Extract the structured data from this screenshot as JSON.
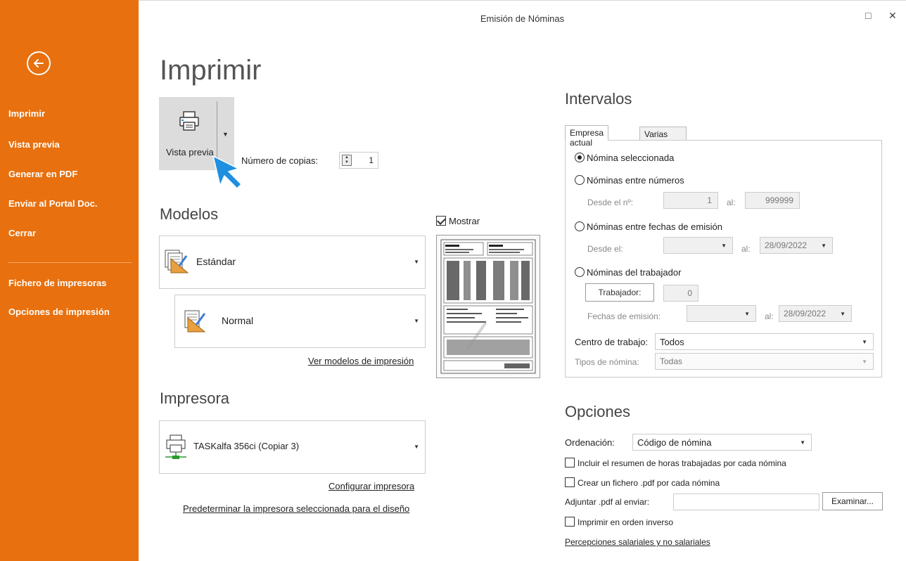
{
  "window": {
    "title": "Emisión de Nóminas",
    "controls": {
      "maximize": "□",
      "close": "✕"
    }
  },
  "sidebar": {
    "items": [
      {
        "label": "Imprimir"
      },
      {
        "label": "Vista previa"
      },
      {
        "label": "Generar en PDF"
      },
      {
        "label": "Enviar al Portal Doc."
      },
      {
        "label": "Cerrar"
      },
      {
        "label": "Fichero de impresoras"
      },
      {
        "label": "Opciones de impresión"
      }
    ]
  },
  "main": {
    "title": "Imprimir",
    "print_button": {
      "label": "Vista previa",
      "icon": "printer-icon"
    },
    "copies": {
      "label": "Número de copias:",
      "value": "1"
    },
    "modelos": {
      "heading": "Modelos",
      "model": "Estándar",
      "submodel": "Normal",
      "link": "Ver modelos de impresión",
      "show_label": "Mostrar",
      "show_checked": true
    },
    "impresora": {
      "heading": "Impresora",
      "printer": "TASKalfa 356ci (Copiar 3)",
      "configure_link": "Configurar impresora",
      "default_link": "Predeterminar la impresora seleccionada para el diseño"
    }
  },
  "intervalos": {
    "heading": "Intervalos",
    "tabs": [
      "Empresa actual",
      "Varias empresas"
    ],
    "opt1": "Nómina seleccionada",
    "opt2": "Nóminas entre números",
    "desde_no_label": "Desde el nº:",
    "desde_no_value": "1",
    "al_label": "al:",
    "al_no_value": "999999",
    "opt3": "Nóminas entre fechas de emisión",
    "desde_el_label": "Desde el:",
    "al_fecha_value": "28/09/2022",
    "opt4": "Nóminas del trabajador",
    "trabajador_label": "Trabajador:",
    "trabajador_value": "0",
    "fechas_emision_label": "Fechas de emisión:",
    "al_fecha2_value": "28/09/2022",
    "centro_label": "Centro de trabajo:",
    "centro_value": "Todos",
    "tipos_label": "Tipos de nómina:",
    "tipos_value": "Todas"
  },
  "opciones": {
    "heading": "Opciones",
    "ordenacion_label": "Ordenación:",
    "ordenacion_value": "Código de nómina",
    "cb1": "Incluir el resumen de horas trabajadas por cada nómina",
    "cb2": "Crear un fichero .pdf por cada nómina",
    "adjuntar_label": "Adjuntar .pdf al enviar:",
    "examinar": "Examinar...",
    "cb3": "Imprimir en orden inverso",
    "link": "Percepciones salariales y no salariales"
  },
  "colors": {
    "sidebar": "#e8700e",
    "button_bg": "#dcdcdc",
    "cursor": "#1f8fe0"
  }
}
